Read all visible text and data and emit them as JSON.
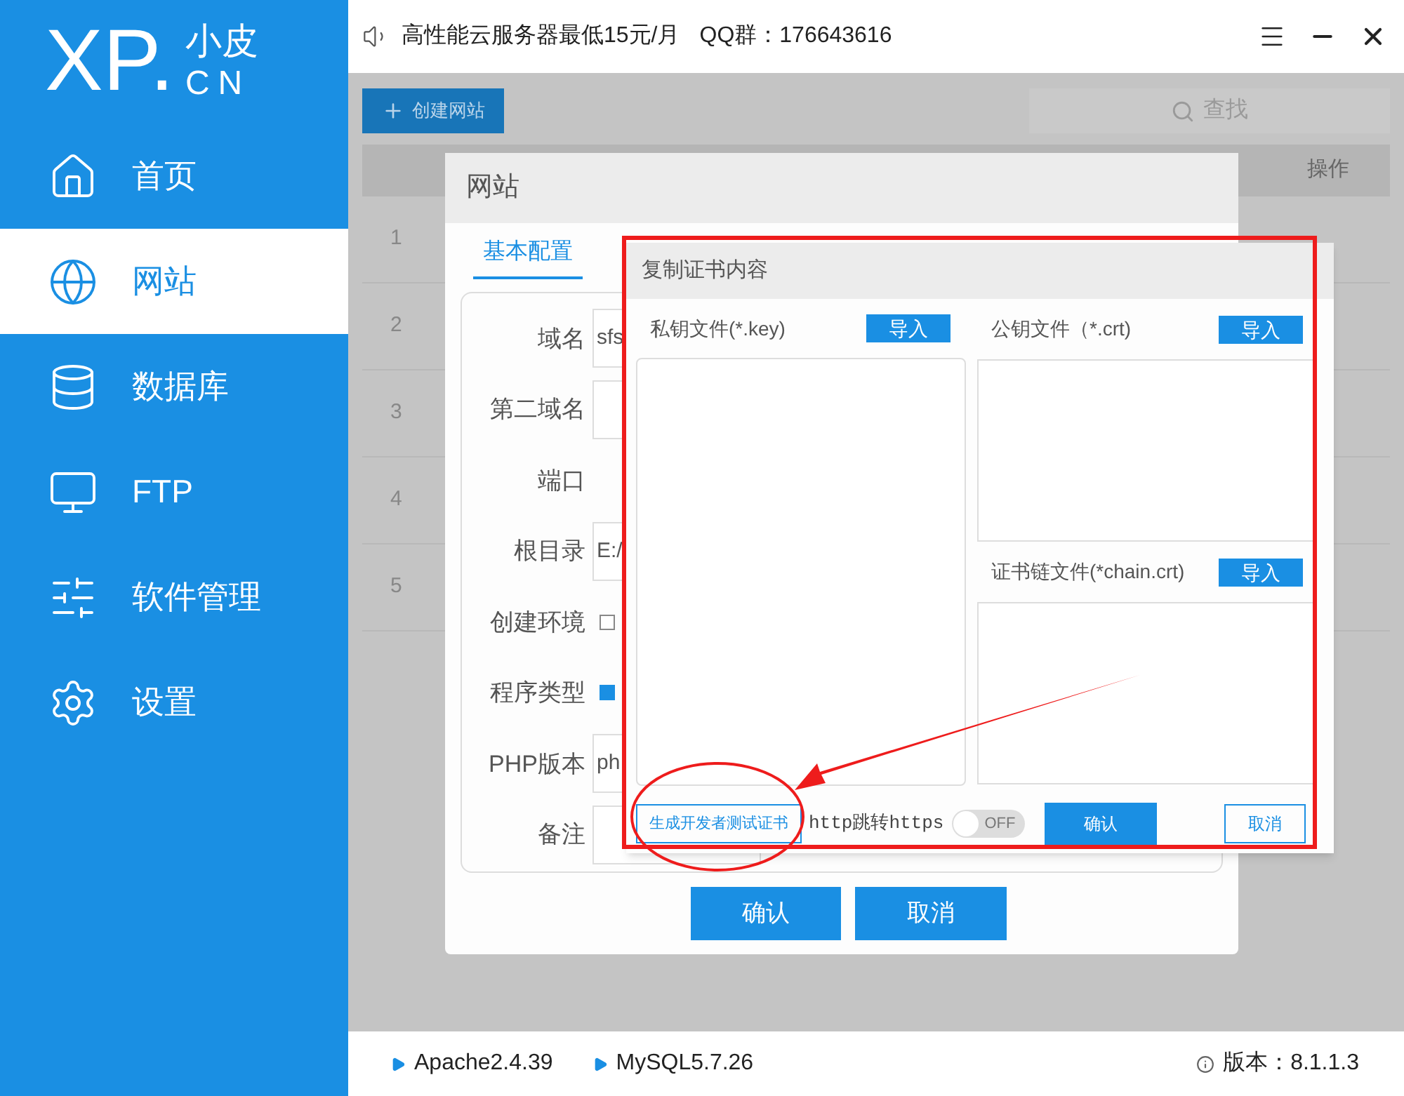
{
  "sidebar": {
    "logo": {
      "text": "XP.",
      "cn": "小皮",
      "en": "CN"
    },
    "items": [
      {
        "label": "首页",
        "selected": false
      },
      {
        "label": "网站",
        "selected": true
      },
      {
        "label": "数据库",
        "selected": false
      },
      {
        "label": "FTP",
        "selected": false
      },
      {
        "label": "软件管理",
        "selected": false
      },
      {
        "label": "设置",
        "selected": false
      }
    ]
  },
  "top_bar": {
    "notice": "高性能云服务器最低15元/月",
    "qq": "QQ群：176643616"
  },
  "toolbar": {
    "create_button": "创建网站",
    "search_placeholder": "查找"
  },
  "table": {
    "columns": [
      "操作"
    ],
    "rows": [
      "1",
      "2",
      "3",
      "4",
      "5"
    ]
  },
  "site_dialog": {
    "title": "网站",
    "tabs": [
      {
        "label": "基本配置",
        "selected": true
      }
    ],
    "fields": [
      {
        "label": "域名",
        "kind": "text",
        "value": "sfs"
      },
      {
        "label": "第二域名",
        "kind": "text"
      },
      {
        "label": "端口",
        "kind": "label"
      },
      {
        "label": "根目录",
        "kind": "text",
        "value": "E:/"
      },
      {
        "label": "创建环境",
        "kind": "checkbox",
        "checked": false
      },
      {
        "label": "程序类型",
        "kind": "checkbox",
        "checked": true
      },
      {
        "label": "PHP版本",
        "kind": "text",
        "value": "ph"
      },
      {
        "label": "备注",
        "kind": "text"
      }
    ],
    "buttons": [
      "确认",
      "取消"
    ]
  },
  "cert_dialog": {
    "title": "复制证书内容",
    "private_key": {
      "label": "私钥文件(*.key)",
      "button": "导入"
    },
    "public_key": {
      "label": "公钥文件（*.crt)",
      "button": "导入"
    },
    "chain": {
      "label": "证书链文件(*chain.crt)",
      "button": "导入"
    },
    "generate_button": "生成开发者测试证书",
    "redirect_label": "http跳转https",
    "redirect_toggle": {
      "on": false,
      "text": "OFF"
    },
    "confirm_button": "确认",
    "cancel_button": "取消"
  },
  "status_bar": {
    "services": [
      "Apache2.4.39",
      "MySQL5.7.26"
    ],
    "version": "版本：8.1.1.3"
  }
}
